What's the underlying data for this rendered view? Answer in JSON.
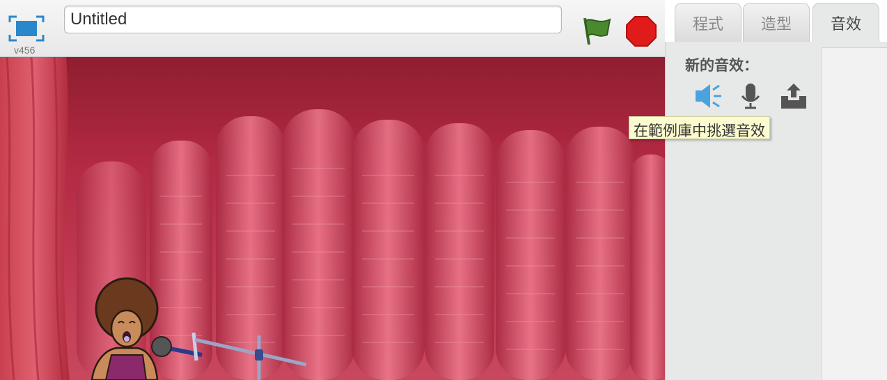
{
  "header": {
    "version": "v456",
    "project_title": "Untitled",
    "fullscreen_icon": "fullscreen-icon",
    "green_flag_icon": "green-flag-icon",
    "stop_icon": "stop-icon"
  },
  "stage": {
    "backdrop": "red-curtain-stage",
    "sprite": "singer-with-microphone-stand",
    "colors": {
      "curtain_dark": "#8f1e30",
      "curtain_light": "#e8687e"
    }
  },
  "editor": {
    "tabs": [
      {
        "label": "程式",
        "active": false
      },
      {
        "label": "造型",
        "active": false
      },
      {
        "label": "音效",
        "active": true
      }
    ],
    "new_sound_label": "新的音效：",
    "sound_buttons": [
      {
        "icon": "speaker-icon",
        "action": "choose-from-library"
      },
      {
        "icon": "microphone-icon",
        "action": "record"
      },
      {
        "icon": "upload-icon",
        "action": "upload"
      }
    ],
    "tooltip": "在範例庫中挑選音效"
  },
  "colors": {
    "accent": "#2a87c9",
    "stop": "#e11a1a",
    "flag": "#4a8a2f"
  }
}
